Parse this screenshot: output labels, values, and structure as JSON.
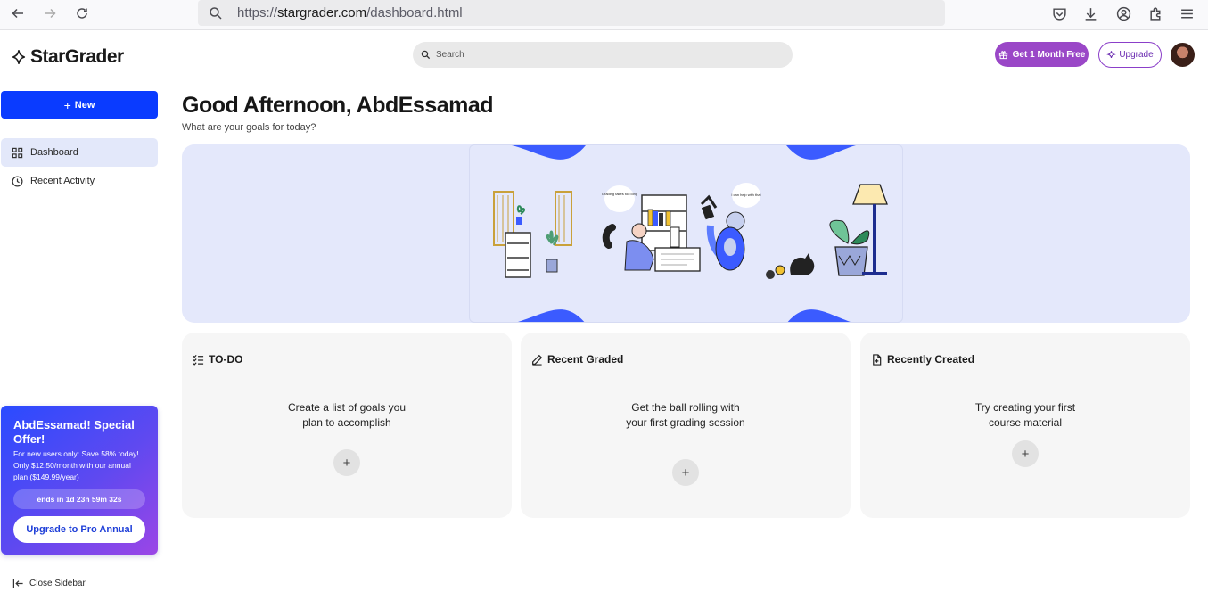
{
  "browser": {
    "url_scheme": "https://",
    "url_host": "stargrader.com",
    "url_path": "/dashboard.html"
  },
  "header": {
    "logo_text": "StarGrader",
    "search_placeholder": "Search",
    "free_button": "Get 1 Month Free",
    "upgrade_button": "Upgrade"
  },
  "sidebar": {
    "new_button": "New",
    "items": [
      {
        "label": "Dashboard",
        "icon": "grid-icon",
        "active": true
      },
      {
        "label": "Recent Activity",
        "icon": "clock-icon",
        "active": false
      }
    ],
    "offer": {
      "title": "AbdEssamad! Special Offer!",
      "text": "For new users only: Save 58% today! Only $12.50/month with our annual plan ($149.99/year)",
      "countdown": "ends in 1d 23h 59m 32s",
      "button": "Upgrade to Pro Annual"
    },
    "close_label": "Close Sidebar"
  },
  "main": {
    "greeting": "Good Afternoon, AbdEssamad",
    "subtitle": "What are your goals for today?",
    "hero": {
      "bubble_left": "Grading takes too long",
      "bubble_right": "I can help with that"
    },
    "cards": [
      {
        "title": "TO-DO",
        "icon": "checklist-icon",
        "line1": "Create a list of goals you",
        "line2": "plan to accomplish"
      },
      {
        "title": "Recent Graded",
        "icon": "pencil-icon",
        "line1": "Get the ball rolling with",
        "line2": "your first grading session"
      },
      {
        "title": "Recently Created",
        "icon": "new-file-icon",
        "line1": "Try creating your first",
        "line2": "course material"
      }
    ],
    "add_symbol": "+"
  },
  "colors": {
    "primary": "#0a3bff",
    "purple": "#9a47c7",
    "hero_bg": "#e4e8fb",
    "hero_accent": "#3b5bff"
  }
}
